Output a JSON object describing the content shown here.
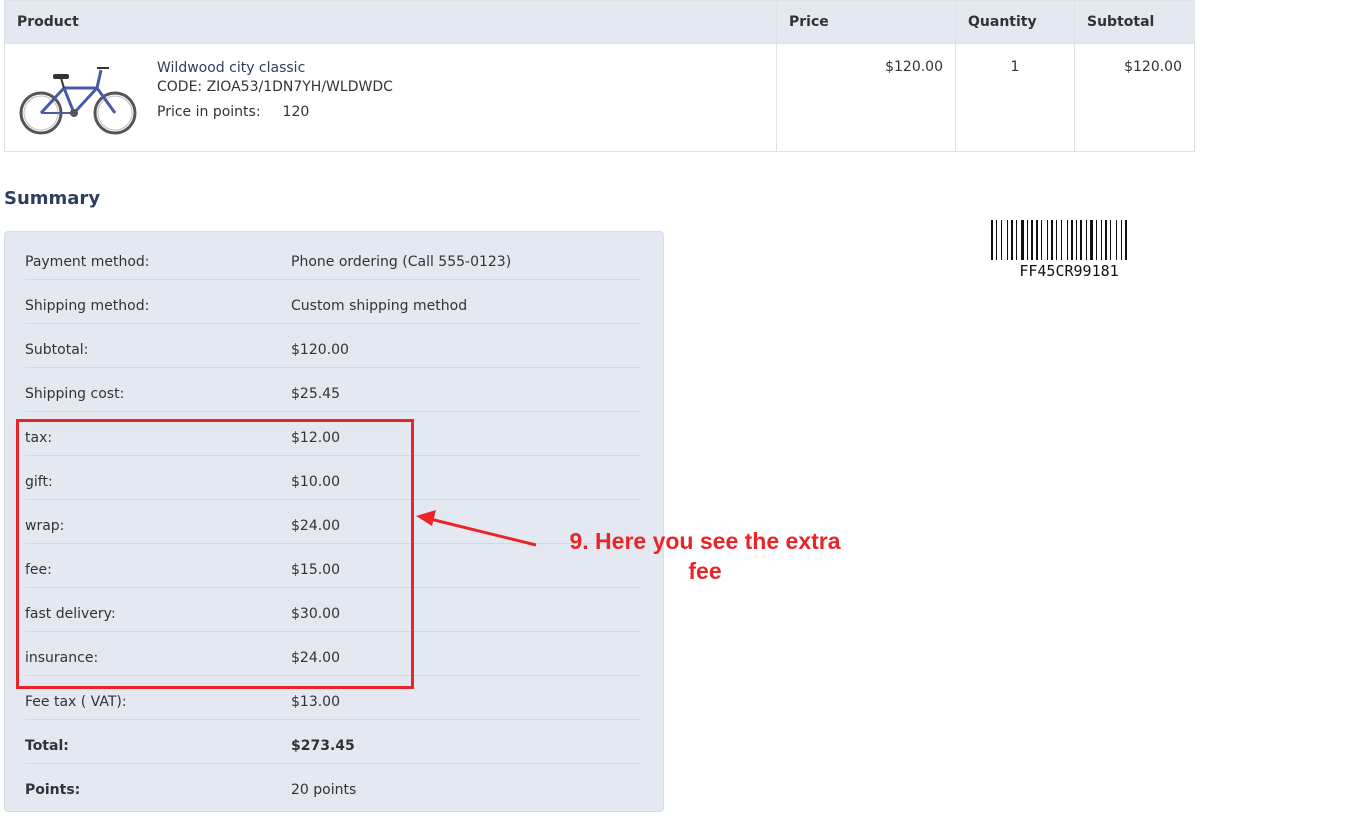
{
  "table": {
    "headers": {
      "product": "Product",
      "price": "Price",
      "quantity": "Quantity",
      "subtotal": "Subtotal"
    },
    "row": {
      "name": "Wildwood city classic",
      "code": "CODE: ZIOA53/1DN7YH/WLDWDC",
      "points_label": "Price in points:",
      "points_value": "120",
      "price": "$120.00",
      "quantity": "1",
      "subtotal": "$120.00"
    }
  },
  "summary": {
    "title": "Summary",
    "rows": [
      {
        "label": "Payment method:",
        "value": "Phone ordering (Call 555-0123)"
      },
      {
        "label": "Shipping method:",
        "value": "Custom shipping method"
      },
      {
        "label": "Subtotal:",
        "value": "$120.00"
      },
      {
        "label": "Shipping cost:",
        "value": "$25.45"
      },
      {
        "label": "tax:",
        "value": "$12.00"
      },
      {
        "label": "gift:",
        "value": "$10.00"
      },
      {
        "label": "wrap:",
        "value": "$24.00"
      },
      {
        "label": "fee:",
        "value": "$15.00"
      },
      {
        "label": "fast delivery:",
        "value": "$30.00"
      },
      {
        "label": "insurance:",
        "value": "$24.00"
      },
      {
        "label": "Fee tax ( VAT):",
        "value": "$13.00"
      },
      {
        "label": "Total:",
        "value": "$273.45"
      },
      {
        "label": "Points:",
        "value": "20 points"
      }
    ]
  },
  "barcode": {
    "text": "FF45CR99181"
  },
  "annotation": {
    "text": "9. Here you see the extra fee",
    "color": "#e8262a"
  }
}
